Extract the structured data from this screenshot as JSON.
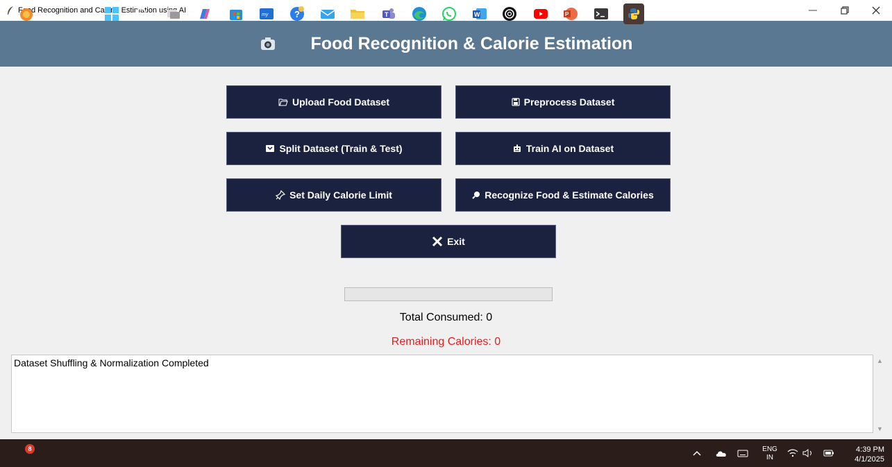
{
  "window": {
    "title": "Food Recognition and Calorie Estimation using AI",
    "controls": {
      "minimize": "—",
      "restore": "⧉",
      "close": "✕"
    }
  },
  "header": {
    "title": "Food Recognition & Calorie Estimation",
    "icon": "camera-icon"
  },
  "buttons": {
    "upload": {
      "label": "Upload Food Dataset",
      "icon": "folder-open-icon"
    },
    "preprocess": {
      "label": "Preprocess Dataset",
      "icon": "save-icon"
    },
    "split": {
      "label": "Split Dataset (Train & Test)",
      "icon": "box-icon"
    },
    "train": {
      "label": "Train AI on Dataset",
      "icon": "robot-icon"
    },
    "calorie_limit": {
      "label": "Set Daily Calorie Limit",
      "icon": "pin-icon"
    },
    "recognize": {
      "label": "Recognize Food & Estimate Calories",
      "icon": "search-icon"
    },
    "exit": {
      "label": "Exit",
      "icon": "close-icon"
    }
  },
  "progress": {
    "value": 0
  },
  "stats": {
    "total_consumed": "Total Consumed: 0",
    "remaining": "Remaining Calories: 0"
  },
  "log": {
    "text": "Dataset Shuffling & Normalization Completed"
  },
  "taskbar": {
    "notification_count": "8",
    "language": "ENG",
    "region": "IN",
    "time": "4:39 PM",
    "date": "4/1/2025"
  },
  "colors": {
    "header_bg": "#5a7891",
    "button_bg": "#1b2240",
    "remaining_text": "#e02020",
    "taskbar_bg": "#2b1d1a"
  }
}
